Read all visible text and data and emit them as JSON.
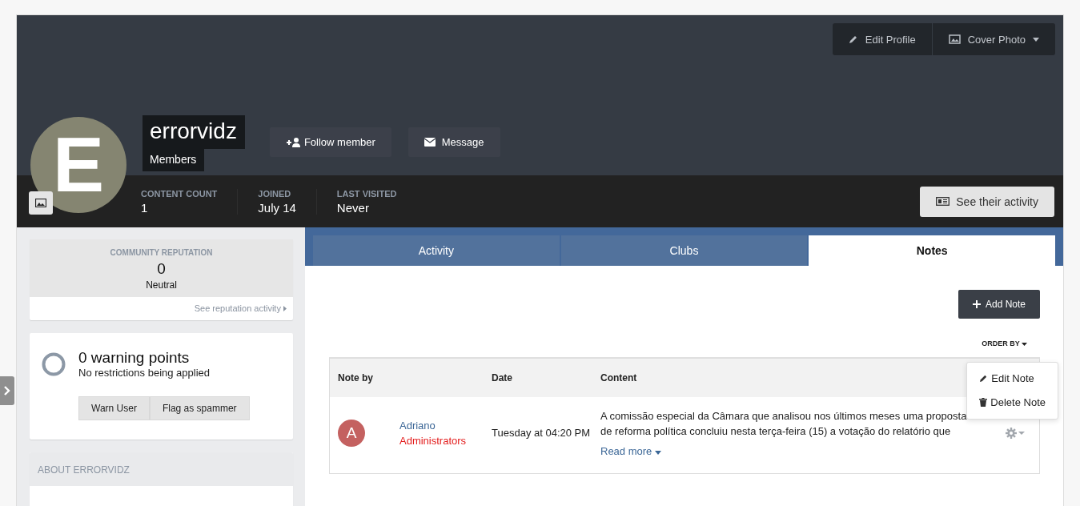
{
  "cover_actions": [
    {
      "kind": "edit",
      "label": "Edit Profile"
    },
    {
      "kind": "photo",
      "label": "Cover Photo"
    }
  ],
  "profile": {
    "initial": "E",
    "name": "errorvidz",
    "group": "Members"
  },
  "profile_actions": [
    {
      "kind": "follow",
      "label": "Follow member"
    },
    {
      "kind": "message",
      "label": "Message"
    }
  ],
  "stats": [
    {
      "label": "CONTENT COUNT",
      "value": "1"
    },
    {
      "label": "JOINED",
      "value": "July 14"
    },
    {
      "label": "LAST VISITED",
      "value": "Never"
    }
  ],
  "activity_button": "See their activity",
  "reputation": {
    "title": "COMMUNITY REPUTATION",
    "value": "0",
    "level_text": "Neutral",
    "link": "See reputation activity"
  },
  "warnings": {
    "title": "0 warning points",
    "subtitle": "No restrictions being applied",
    "buttons": [
      "Warn User",
      "Flag as spammer"
    ]
  },
  "about": {
    "title": "ABOUT ERRORVIDZ"
  },
  "tabs": [
    {
      "label": "Activity",
      "selected": false
    },
    {
      "label": "Clubs",
      "selected": false
    },
    {
      "label": "Notes",
      "selected": true
    }
  ],
  "add_note": "Add Note",
  "order_by": "ORDER BY",
  "table": {
    "columns": [
      "Note by",
      "Date",
      "Content"
    ],
    "rows": [
      {
        "avatar": "A",
        "author": "Adriano",
        "group": "Administrators",
        "date": "Tuesday at 04:20 PM",
        "content": "A comissão especial da Câmara que analisou nos últimos meses uma proposta de reforma política concluiu nesta terça-feira (15) a votação do relatório que",
        "read_more": "Read more"
      }
    ]
  },
  "note_menu": [
    {
      "kind": "edit",
      "label": "Edit Note"
    },
    {
      "kind": "delete",
      "label": "Delete Note"
    }
  ]
}
